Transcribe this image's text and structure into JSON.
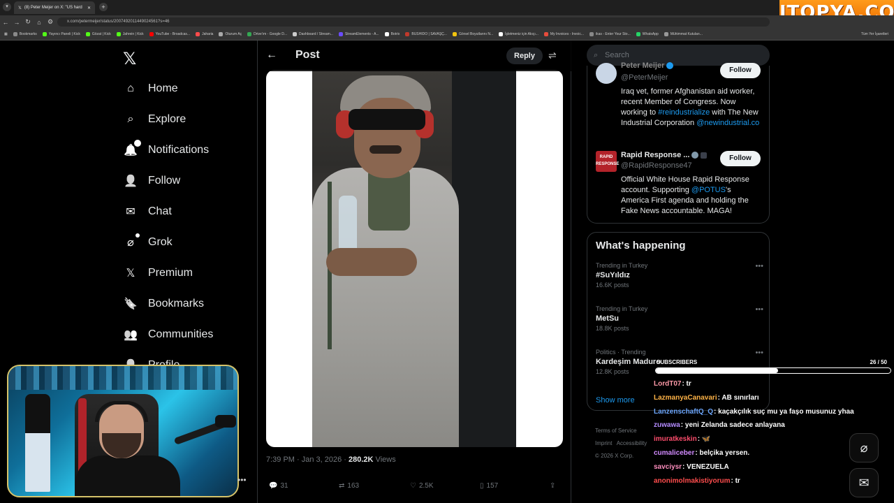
{
  "browser": {
    "tab_title": "(8) Peter Meijer on X: \"US hard",
    "url": "x.com/petermeijer/status/2007492011449024561?s=46",
    "bookmarks": [
      {
        "label": "Bookmarks",
        "color": "#8a8a8a"
      },
      {
        "label": "Yayıncı Paneli | Kick",
        "color": "#53fc18"
      },
      {
        "label": "Gözat | Kick",
        "color": "#53fc18"
      },
      {
        "label": "Jahrein | Kick",
        "color": "#53fc18"
      },
      {
        "label": "YouTube - Broadcas...",
        "color": "#ff0000"
      },
      {
        "label": "Jaharia",
        "color": "#ff4b4b"
      },
      {
        "label": "Oturum Aç",
        "color": "#aaaaaa"
      },
      {
        "label": "Drive'ım - Google D...",
        "color": "#34a853"
      },
      {
        "label": "Dashboard / Stream...",
        "color": "#cccccc"
      },
      {
        "label": "StreamElements - A...",
        "color": "#6a4cff"
      },
      {
        "label": "Botrix",
        "color": "#ffffff"
      },
      {
        "label": "BUSHIDO | SAVAŞÇ...",
        "color": "#c0392b"
      },
      {
        "label": "Görsel Boyutlarını N...",
        "color": "#f1c40f"
      },
      {
        "label": "İşletmeniz için Akıçı...",
        "color": "#ffffff"
      },
      {
        "label": "My Invoices - Invoic...",
        "color": "#e74c3c"
      },
      {
        "label": "ikas - Enter Your Sto...",
        "color": "#888888"
      },
      {
        "label": "WhatsApp",
        "color": "#25d366"
      },
      {
        "label": "Mühimmat Kutuları...",
        "color": "#999999"
      }
    ],
    "all_bookmarks": "Tüm Yer İşaretleri"
  },
  "watermark": "ITOPYA.COM",
  "nav": {
    "items": [
      {
        "label": "Home",
        "icon": "home-icon"
      },
      {
        "label": "Explore",
        "icon": "search-icon"
      },
      {
        "label": "Notifications",
        "icon": "bell-icon",
        "badge": "8"
      },
      {
        "label": "Follow",
        "icon": "add-user-icon"
      },
      {
        "label": "Chat",
        "icon": "mail-icon"
      },
      {
        "label": "Grok",
        "icon": "grok-icon"
      },
      {
        "label": "Premium",
        "icon": "x-icon"
      },
      {
        "label": "Bookmarks",
        "icon": "bookmark-icon"
      },
      {
        "label": "Communities",
        "icon": "people-icon"
      },
      {
        "label": "Profile",
        "icon": "user-icon"
      }
    ]
  },
  "post": {
    "header_title": "Post",
    "reply_label": "Reply",
    "time": "7:39 PM · Jan 3, 2026 · ",
    "views": "280.2K",
    "views_label": " Views",
    "replies": "31",
    "reposts": "163",
    "likes": "2.5K",
    "bookmarks": "157"
  },
  "sidebar": {
    "search_placeholder": "Search",
    "accounts": [
      {
        "name": "Peter Meijer",
        "handle": "@PeterMeijer",
        "follow": "Follow",
        "bio_parts": [
          "Iraq vet, former Afghanistan aid worker, recent Member of Congress. Now working to ",
          "#reindustrialize",
          " with The New Industrial Corporation ",
          "@newindustrial.co"
        ]
      },
      {
        "name": "Rapid Response ...",
        "handle": "@RapidResponse47",
        "follow": "Follow",
        "avatar_text": "RAPID RESPONSE",
        "bio_parts": [
          "Official White House Rapid Response account. Supporting ",
          "@POTUS",
          "'s America First agenda and holding the Fake News accountable. MAGA!"
        ]
      }
    ],
    "happening_title": "What's happening",
    "trends": [
      {
        "context": "Trending in Turkey",
        "topic": "#SuYıldız",
        "count": "16.6K posts"
      },
      {
        "context": "Trending in Turkey",
        "topic": "MetSu",
        "count": "18.8K posts"
      },
      {
        "context": "Politics · Trending",
        "topic": "Kardeşim Maduro",
        "count": "12.8K posts"
      }
    ],
    "show_more": "Show more",
    "footer": [
      "Terms of Service",
      "Imprint",
      "Accessibility",
      "© 2026 X Corp."
    ]
  },
  "stream": {
    "subscribers_label": "SUBSCRIBERS",
    "subscribers_count": "26 / 50",
    "subscribers_progress": 0.52,
    "chat": [
      {
        "user": "LordT07",
        "color": "#ff9aa8",
        "msg": ": tr"
      },
      {
        "user": "LazmanyaCanavari",
        "color": "#ffb347",
        "msg": ": AB sınırları"
      },
      {
        "user": "LanzenschaftQ_Q",
        "color": "#6ea8ff",
        "msg": ": kaçakçılık suç mu ya faşo musunuz yhaa"
      },
      {
        "user": "zuwawa",
        "color": "#b48cff",
        "msg": ": yeni Zelanda sadece anlayana"
      },
      {
        "user": "imuratkeskin",
        "color": "#ff4d6d",
        "msg": ": 🦋"
      },
      {
        "user": "cumaliceber",
        "color": "#d28bff",
        "msg": ": belçika yersen."
      },
      {
        "user": "savciysr",
        "color": "#ff8fbf",
        "msg": ": VENEZUELA"
      },
      {
        "user": "anonimolmakistiyorum",
        "color": "#ff4d4d",
        "msg": ": tr"
      }
    ]
  }
}
